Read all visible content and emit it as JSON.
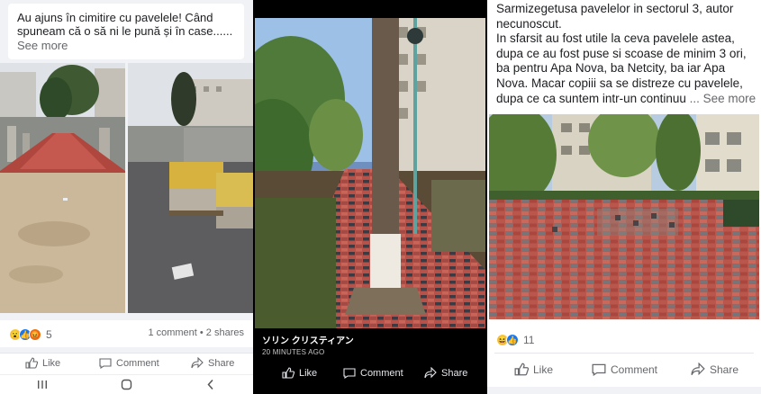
{
  "panel1": {
    "post_text": "Au ajuns în cimitire cu pavelele! Când spuneam că o să ni le pună și în case......",
    "see_more": "See more",
    "reaction_count": "5",
    "stats": "1 comment • 2 shares",
    "actions": {
      "like": "Like",
      "comment": "Comment",
      "share": "Share"
    },
    "nav_icons": [
      "recent-apps-icon",
      "home-icon",
      "back-icon"
    ]
  },
  "panel2": {
    "author": "ソリン クリスティアン",
    "time": "20 MINUTES AGO",
    "actions": {
      "like": "Like",
      "comment": "Comment",
      "share": "Share"
    }
  },
  "panel3": {
    "post_text": "Sarmizegetusa pavelelor in sectorul 3, autor necunoscut.\nIn sfarsit au fost utile la ceva pavelele astea, dupa ce au fost puse si scoase de minim 3 ori, ba pentru Apa Nova, ba Netcity, ba iar Apa Nova. Macar copiii sa se distreze cu pavelele, dupa ce ca suntem intr-un continuu",
    "see_more": "... See more",
    "reaction_count": "11",
    "actions": {
      "like": "Like",
      "comment": "Comment",
      "share": "Share"
    }
  },
  "colors": {
    "fb_grey_text": "#65676b",
    "paver_red": "#b5524a",
    "paver_dark": "#3c3a42"
  }
}
